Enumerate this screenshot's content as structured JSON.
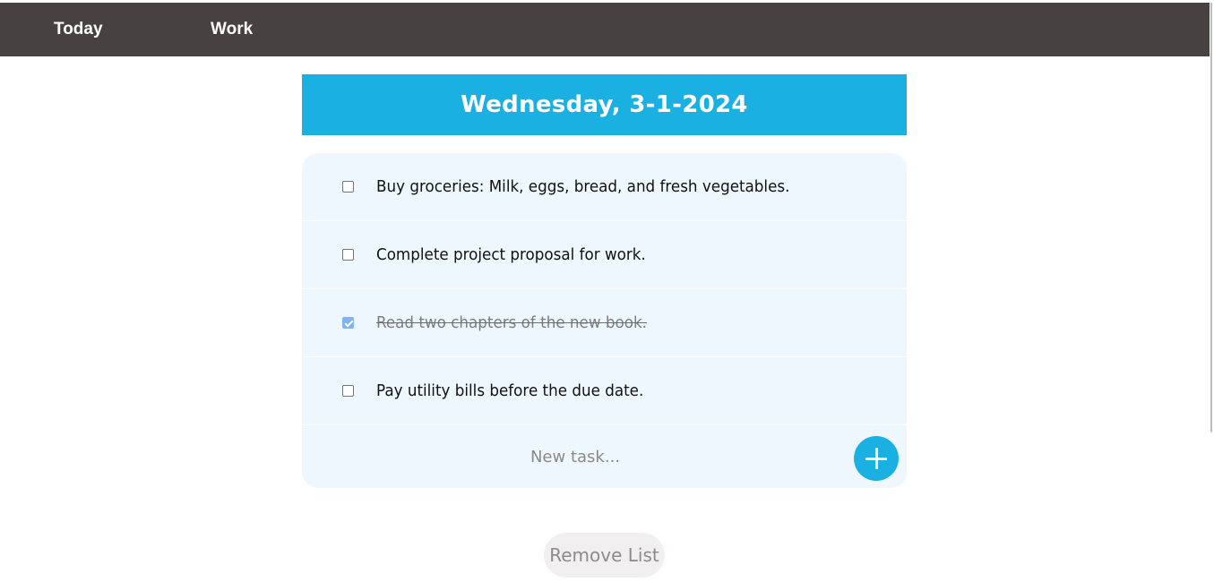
{
  "nav": {
    "items": [
      {
        "label": "Today"
      },
      {
        "label": "Work"
      }
    ]
  },
  "list": {
    "date_title": "Wednesday, 3-1-2024",
    "tasks": [
      {
        "text": "Buy groceries: Milk, eggs, bread, and fresh vegetables.",
        "checked": false
      },
      {
        "text": "Complete project proposal for work.",
        "checked": false
      },
      {
        "text": "Read two chapters of the new book.",
        "checked": true
      },
      {
        "text": "Pay utility bills before the due date.",
        "checked": false
      }
    ],
    "new_task": {
      "placeholder": "New task...",
      "value": ""
    },
    "remove_label": "Remove List"
  },
  "colors": {
    "navbar": "#474241",
    "accent": "#1ab0e1",
    "panel": "#eff7fe",
    "checkbox_checked": "#7fb4f2",
    "remove_button_bg": "#f2eff1"
  },
  "icons": {
    "add": "plus-icon"
  }
}
